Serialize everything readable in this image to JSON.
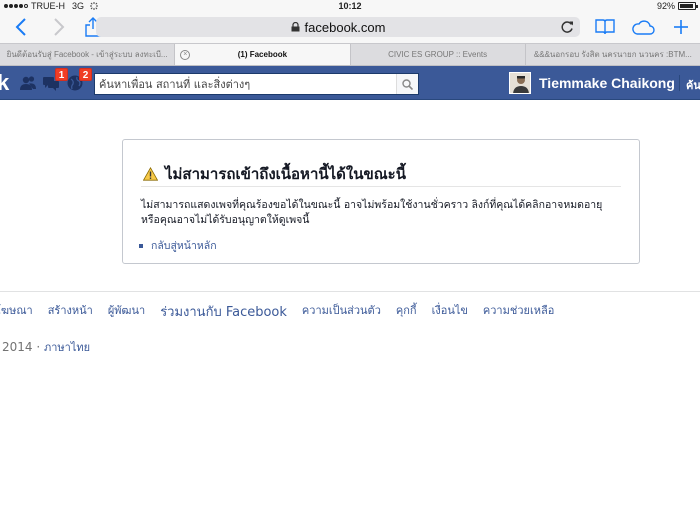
{
  "status_bar": {
    "carrier": "TRUE-H",
    "network": "3G",
    "time": "10:12",
    "battery_percent": "92%",
    "battery_level": 0.92
  },
  "browser": {
    "url": "facebook.com",
    "icons": [
      "back-icon",
      "forward-icon",
      "share-icon",
      "lock-icon",
      "reload-icon",
      "bookmarks-icon",
      "cloud-tabs-icon",
      "new-tab-icon"
    ],
    "accent_color": "#1a7cf5",
    "tabs": [
      {
        "title": "ยินดีต้อนรับสู่ Facebook - เข้าสู่ระบบ ลงทะเบี...",
        "active": false
      },
      {
        "title": "(1) Facebook",
        "active": true
      },
      {
        "title": "CIVIC ES GROUP :: Events",
        "active": false
      },
      {
        "title": "&&&นอกรอบ รังสิต นครนายก นวนคร :BTM...",
        "active": false
      }
    ]
  },
  "facebook_header": {
    "logo_fragment": "k",
    "brand_color": "#3b5998",
    "jewels": [
      {
        "icon": "friend-requests-icon",
        "badge": ""
      },
      {
        "icon": "messages-icon",
        "badge": "1"
      },
      {
        "icon": "notifications-globe-icon",
        "badge": "2"
      }
    ],
    "search_placeholder": "ค้นหาเพื่อน สถานที่ และสิ่งต่างๆ",
    "user_name": "Tiemmake Chaikong",
    "home_fragment": "ค้น"
  },
  "error": {
    "title": "ไม่สามารถเข้าถึงเนื้อหานี้ได้ในขณะนี้",
    "message": "ไม่สามารถแสดงเพจที่คุณร้องขอได้ในขณะนี้ อาจไม่พร้อมใช้งานชั่วคราว ลิงก์ที่คุณได้คลิกอาจหมดอายุ หรือคุณอาจไม่ได้รับอนุญาตให้ดูเพจนี้",
    "back_link": "กลับสู่หน้าหลัก",
    "icon": "warning-icon"
  },
  "footer": {
    "links": [
      "โฆษณา",
      "สร้างหน้า",
      "ผู้พัฒนา",
      "ร่วมงานกับ Facebook",
      "ความเป็นส่วนตัว",
      "คุกกี้",
      "เงื่อนไข",
      "ความช่วยเหลือ"
    ],
    "copyright": "2014 ·",
    "language": "ภาษาไทย"
  }
}
